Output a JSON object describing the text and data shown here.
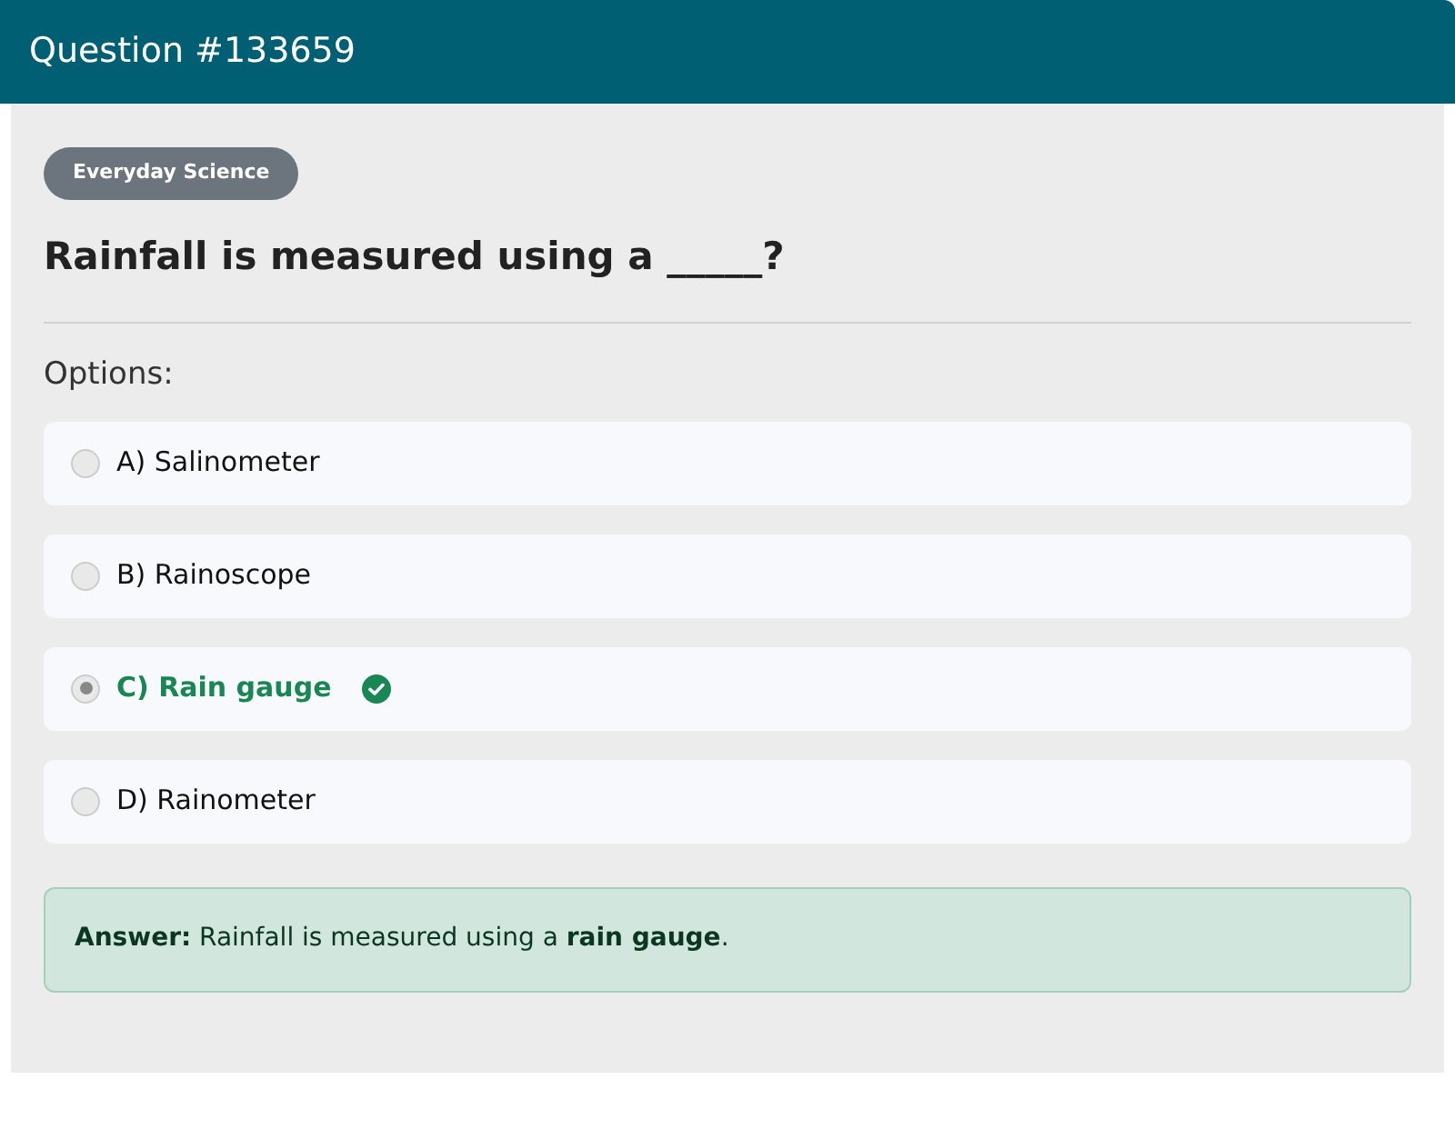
{
  "header": {
    "title": "Question #133659"
  },
  "category": {
    "label": "Everyday Science"
  },
  "question": "Rainfall is measured using a _____?",
  "options_label": "Options:",
  "options": [
    {
      "label": "A) Salinometer",
      "selected": false,
      "correct": false
    },
    {
      "label": "B) Rainoscope",
      "selected": false,
      "correct": false
    },
    {
      "label": "C) Rain gauge",
      "selected": true,
      "correct": true
    },
    {
      "label": "D) Rainometer",
      "selected": false,
      "correct": false
    }
  ],
  "answer": "**Answer:** Rainfall is measured using a **rain gauge**."
}
